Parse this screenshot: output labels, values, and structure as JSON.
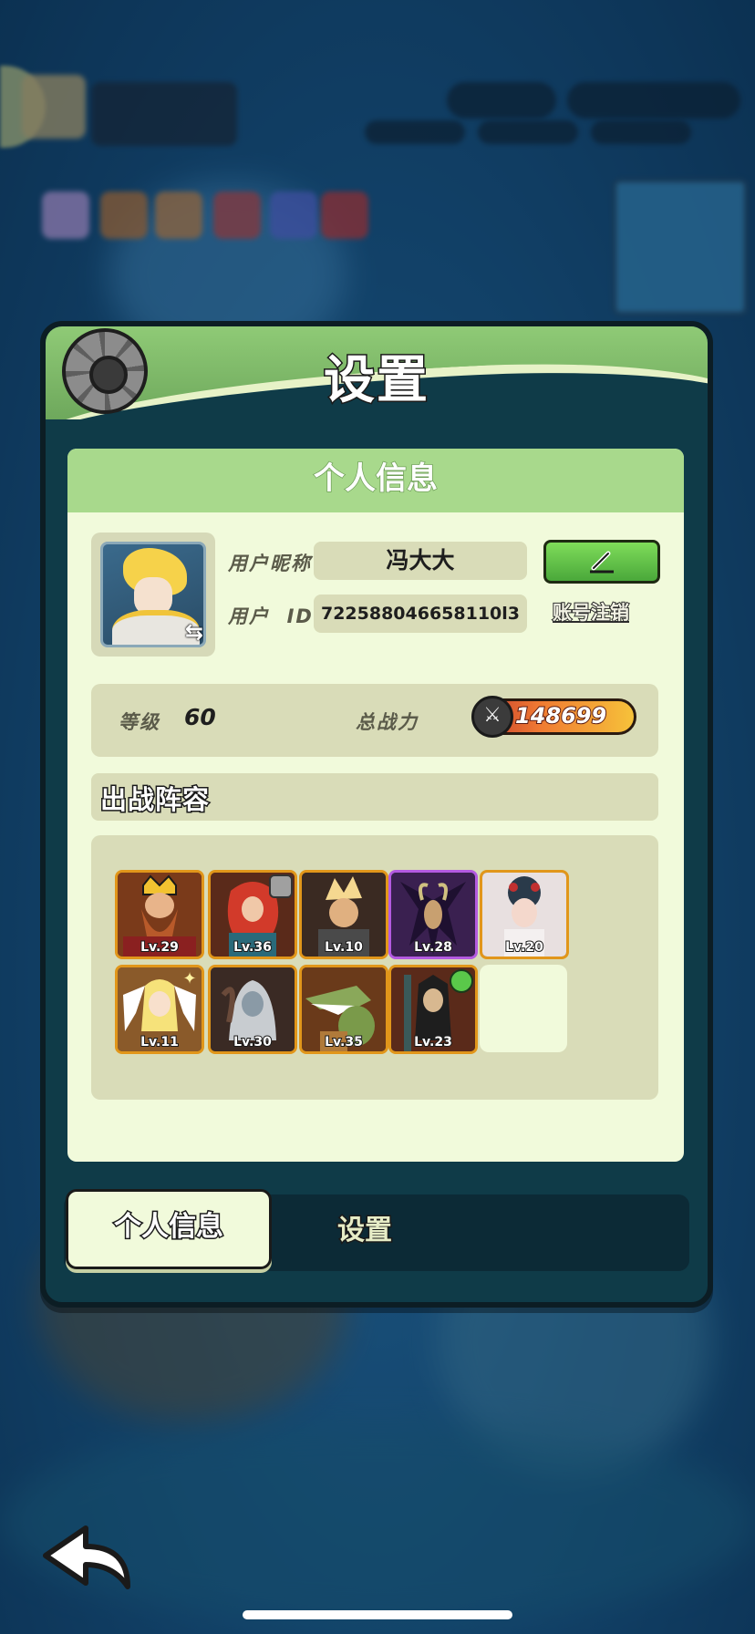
{
  "panel": {
    "title": "设置"
  },
  "personal_info": {
    "section_title": "个人信息",
    "nickname_label": "用户昵称",
    "nickname": "冯大大",
    "id_label": "用户  ID",
    "user_id": "722588046658110l3",
    "account_cancel_label": "账号注销",
    "level_label": "等级",
    "level": "60",
    "power_label": "总战力",
    "power": "148699"
  },
  "lineup": {
    "title": "出战阵容",
    "heroes": [
      {
        "level": "Lv.29",
        "rarity": "legendary"
      },
      {
        "level": "Lv.36",
        "rarity": "legendary"
      },
      {
        "level": "Lv.10",
        "rarity": "legendary"
      },
      {
        "level": "Lv.28",
        "rarity": "epic"
      },
      {
        "level": "Lv.20",
        "rarity": "legendary"
      },
      {
        "level": "Lv.11",
        "rarity": "legendary"
      },
      {
        "level": "Lv.30",
        "rarity": "legendary"
      },
      {
        "level": "Lv.35",
        "rarity": "legendary"
      },
      {
        "level": "Lv.23",
        "rarity": "legendary"
      }
    ]
  },
  "tabs": [
    {
      "label": "个人信息",
      "active": true
    },
    {
      "label": "设置",
      "active": false
    }
  ],
  "icons": {
    "header": "gear-icon",
    "edit": "pencil-icon",
    "power": "crossed-swords-icon",
    "back": "back-arrow-icon",
    "swap": "swap-icon"
  },
  "colors": {
    "header_green": "#8fca76",
    "panel_bg": "#f1fadb",
    "edit_green": "#4aa83a",
    "legendary_border": "#e1961a",
    "epic_border": "#b35ae0"
  }
}
